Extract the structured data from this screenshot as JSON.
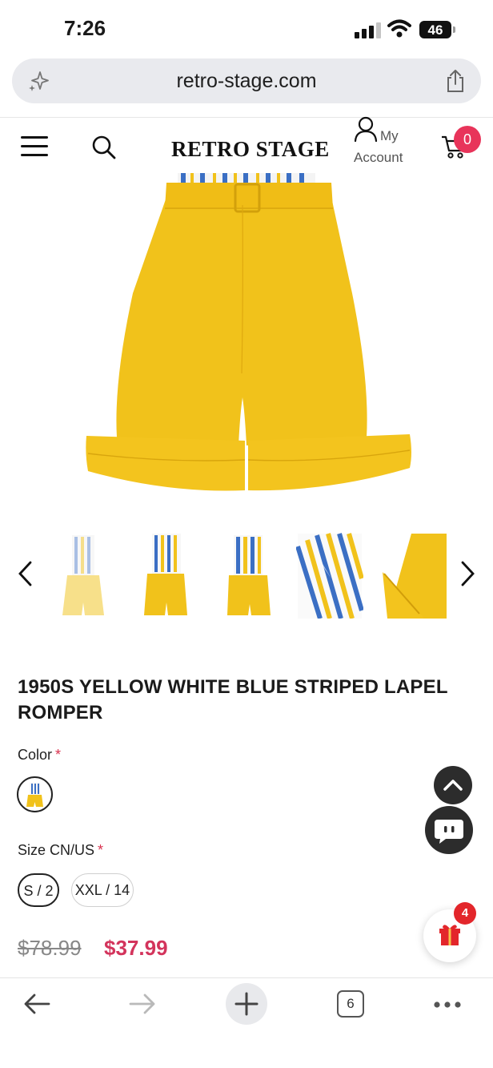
{
  "status_bar": {
    "time": "7:26",
    "battery": "46"
  },
  "browser": {
    "url": "retro-stage.com",
    "tab_count": "6"
  },
  "header": {
    "brand": "RETRO STAGE",
    "account_line1": "My",
    "account_line2": "Account",
    "cart_count": "0"
  },
  "product": {
    "title": "1950S YELLOW WHITE BLUE STRIPED LAPEL ROMPER",
    "color_label": "Color",
    "size_label": "Size CN/US",
    "required_mark": "*",
    "sizes": [
      "S / 2",
      "XXL / 14"
    ],
    "selected_size": "S / 2",
    "price_original": "$78.99",
    "price_sale": "$37.99"
  },
  "gallery": {
    "thumbnail_count": 5
  },
  "floating": {
    "gift_count": "4"
  },
  "colors": {
    "accent": "#d3345c",
    "badge": "#e8345a",
    "product_yellow": "#f1c21b",
    "stripe_blue": "#3b6fc4"
  },
  "icons": {
    "menu": "menu-icon",
    "search": "search-icon",
    "account": "user-icon",
    "cart": "cart-icon",
    "share": "share-icon",
    "gallery_prev": "chevron-left-icon",
    "gallery_next": "chevron-right-icon",
    "scroll_top": "chevron-up-icon",
    "chat": "chat-icon",
    "gift": "gift-icon"
  }
}
